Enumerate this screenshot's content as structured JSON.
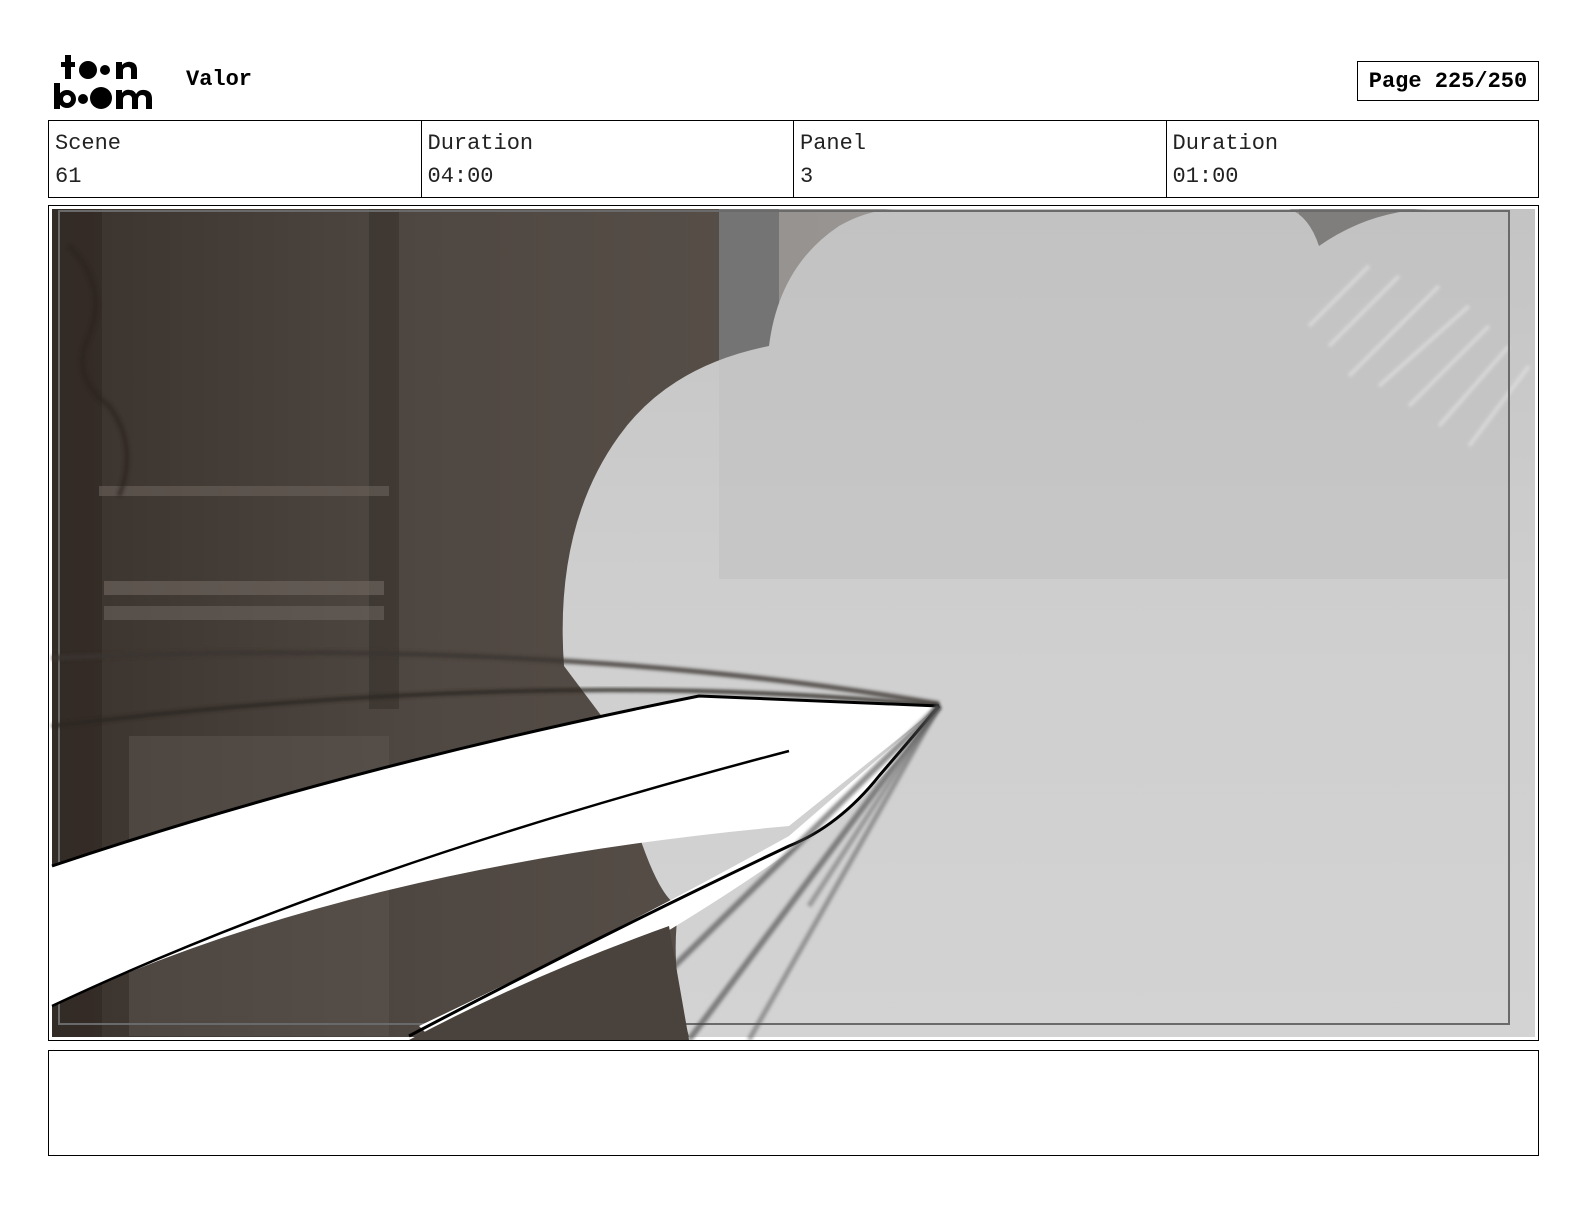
{
  "header": {
    "logo": {
      "text_line1": "toon",
      "text_line2": "boom",
      "icon": "toon-boom-logo"
    },
    "project_title": "Valor",
    "page_label": "Page 225/250"
  },
  "info": {
    "scene_label": "Scene",
    "scene_value": "61",
    "scene_duration_label": "Duration",
    "scene_duration_value": "04:00",
    "panel_label": "Panel",
    "panel_value": "3",
    "panel_duration_label": "Duration",
    "panel_duration_value": "01:00"
  },
  "panel_image": {
    "icon": "storyboard-sketch-blade-smoke"
  },
  "notes": {
    "text": ""
  },
  "colors": {
    "border": "#000000",
    "background": "#ffffff",
    "sepia_dark": "#4f4741",
    "smoke_gray": "#c9c9c9"
  }
}
